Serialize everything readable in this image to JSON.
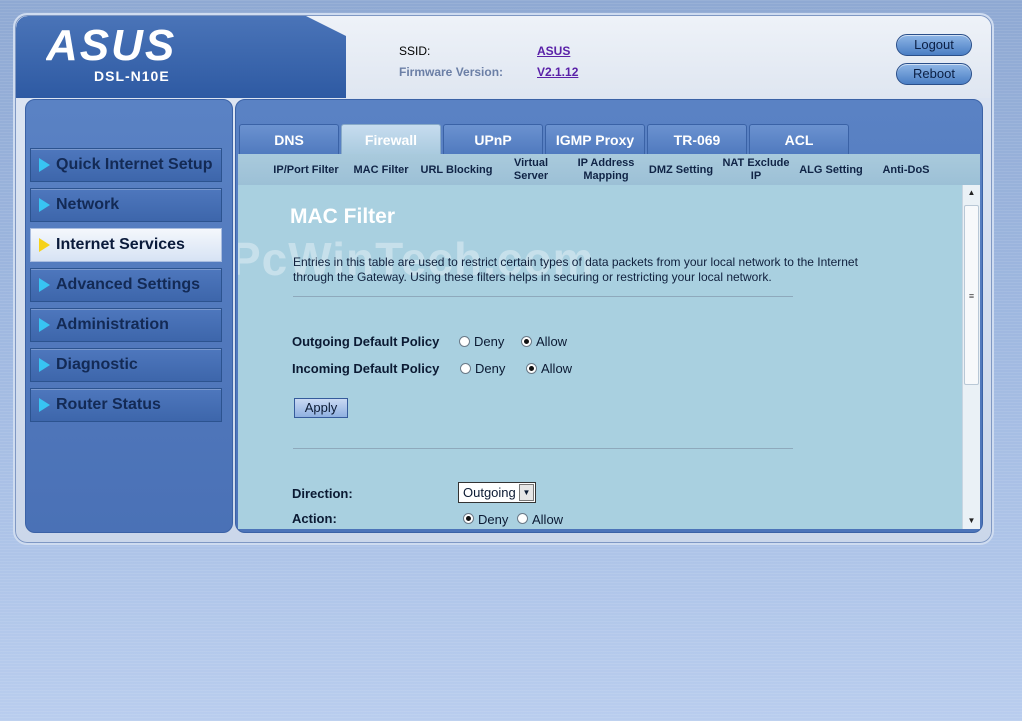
{
  "header": {
    "brand": "ASUS",
    "model": "DSL-N10E",
    "ssid_label": "SSID:",
    "ssid_value": "ASUS",
    "firmware_label": "Firmware Version:",
    "firmware_value": "V2.1.12",
    "logout_label": "Logout",
    "reboot_label": "Reboot"
  },
  "sidebar": {
    "items": [
      {
        "label": "Quick Internet Setup"
      },
      {
        "label": "Network"
      },
      {
        "label": "Internet Services"
      },
      {
        "label": "Advanced Settings"
      },
      {
        "label": "Administration"
      },
      {
        "label": "Diagnostic"
      },
      {
        "label": "Router Status"
      }
    ],
    "active_index": 2
  },
  "tabs": [
    "DNS",
    "Firewall",
    "UPnP",
    "IGMP Proxy",
    "TR-069",
    "ACL"
  ],
  "active_tab": "Firewall",
  "subnav": [
    "IP/Port Filter",
    "MAC Filter",
    "URL Blocking",
    "Virtual Server",
    "IP Address Mapping",
    "DMZ Setting",
    "NAT Exclude IP",
    "ALG Setting",
    "Anti-DoS"
  ],
  "page": {
    "title": "MAC Filter",
    "description": "Entries in this table are used to restrict certain types of data packets from your local network to the Internet through the Gateway. Using these filters helps in securing or restricting your local network.",
    "watermark": "PcWinTech.com",
    "outgoing_policy_label": "Outgoing Default Policy",
    "incoming_policy_label": "Incoming Default Policy",
    "deny_label": "Deny",
    "allow_label": "Allow",
    "outgoing_policy_value": "Allow",
    "incoming_policy_value": "Allow",
    "apply_label": "Apply",
    "direction_label": "Direction:",
    "direction_value": "Outgoing",
    "action_label": "Action:",
    "action_value": "Deny"
  }
}
